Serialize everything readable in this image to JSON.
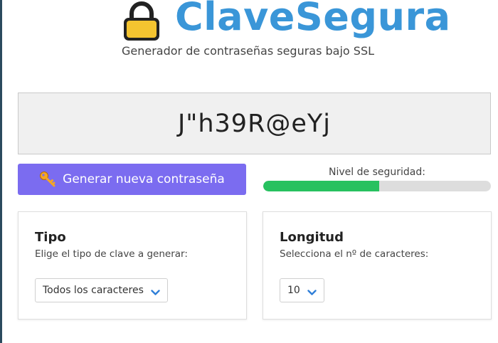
{
  "header": {
    "brand": "ClaveSegura",
    "tagline": "Generador de contraseñas seguras bajo SSL",
    "icon": "lock-icon"
  },
  "password": {
    "value": "J\"h39R@eYj"
  },
  "generate_button": {
    "label": "Generar nueva contraseña",
    "icon": "key-icon"
  },
  "security": {
    "label": "Nivel de seguridad:",
    "level_fraction": 0.51,
    "color": "#27c15f"
  },
  "type_card": {
    "title": "Tipo",
    "subtitle": "Elige el tipo de clave a generar:",
    "selected": "Todos los caracteres"
  },
  "length_card": {
    "title": "Longitud",
    "subtitle": "Selecciona el nº de caracteres:",
    "selected": "10"
  },
  "colors": {
    "brand": "#3a96d8",
    "button": "#7b6cf0",
    "progress": "#27c15f"
  }
}
